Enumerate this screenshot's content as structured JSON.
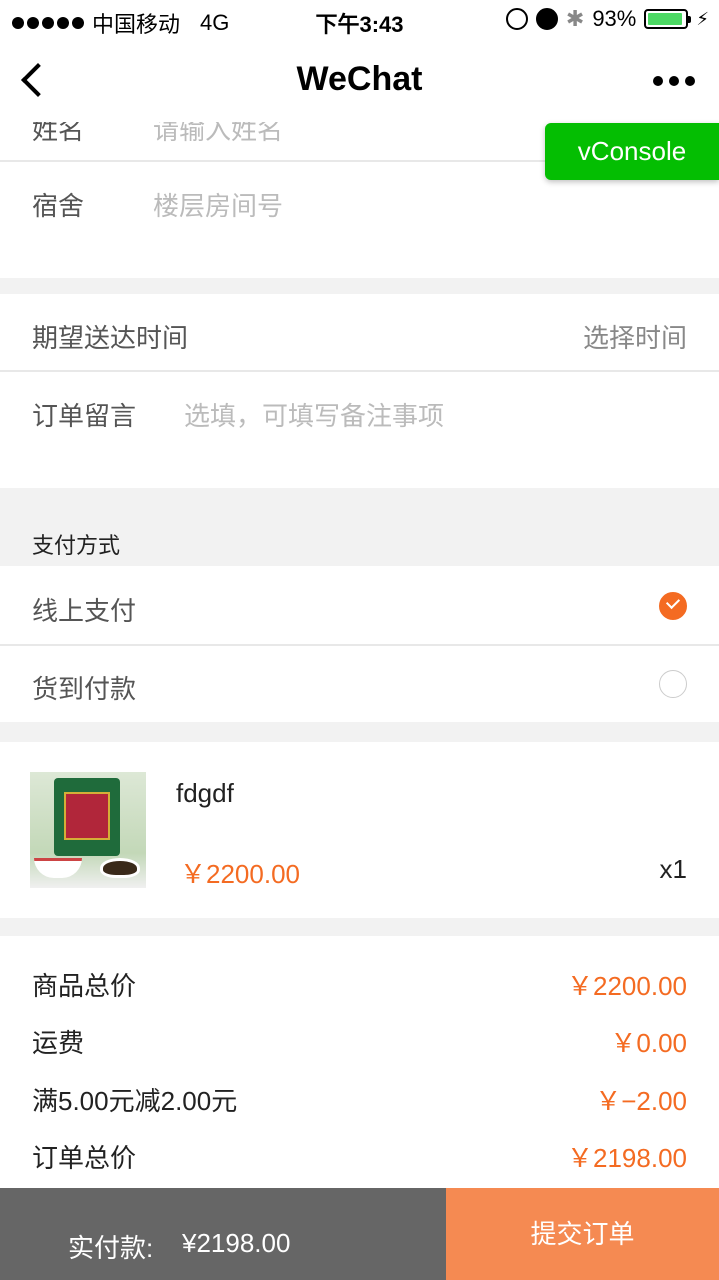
{
  "status_bar": {
    "carrier": "中国移动",
    "network": "4G",
    "time": "下午3:43",
    "battery": "93%",
    "battery_level": 0.93
  },
  "nav": {
    "title": "WeChat"
  },
  "vconsole": {
    "label": "vConsole"
  },
  "form": {
    "name_label": "姓名",
    "name_placeholder": "请输入姓名",
    "dorm_label": "宿舍",
    "dorm_placeholder": "楼层房间号",
    "delivery_time_label": "期望送达时间",
    "delivery_time_value": "选择时间",
    "note_label": "订单留言",
    "note_placeholder": "选填，可填写备注事项"
  },
  "payment": {
    "section_title": "支付方式",
    "options": [
      {
        "label": "线上支付",
        "checked": true
      },
      {
        "label": "货到付款",
        "checked": false
      }
    ]
  },
  "product": {
    "name": "fdgdf",
    "price": "￥2200.00",
    "qty": "x1"
  },
  "summary": {
    "items": [
      {
        "label": "商品总价",
        "value": "￥2200.00"
      },
      {
        "label": "运费",
        "value": "￥0.00"
      },
      {
        "label": "满5.00元减2.00元",
        "value": "￥−2.00"
      },
      {
        "label": "订单总价",
        "value": "￥2198.00"
      }
    ]
  },
  "bottom": {
    "pay_label": "实付款:",
    "pay_value": "¥2198.00",
    "submit_label": "提交订单"
  },
  "colors": {
    "accent": "#f46b22",
    "submit_bg": "#f58a52",
    "vconsole_bg": "#04be02"
  }
}
